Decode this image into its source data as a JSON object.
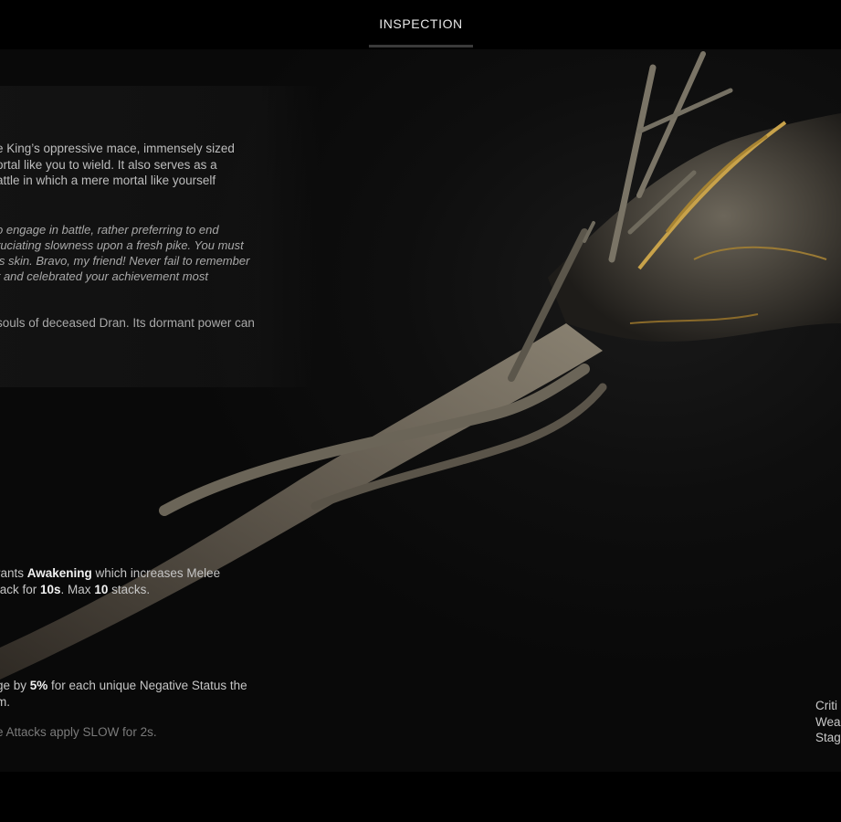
{
  "header": {
    "tab_label": "INSPECTION"
  },
  "lore": {
    "main": [
      "e King’s oppressive mace, immensely sized",
      "ortal like you to wield. It also serves as a",
      "attle in which a mere mortal like yourself"
    ],
    "quote": [
      "o engage in battle, rather preferring to end",
      "ruciating slowness upon a fresh pike. You must",
      "is skin. Bravo, my friend! Never fail to remember",
      "r and celebrated your achievement most"
    ],
    "souls": [
      "souls of deceased Dran. Its dormant power can"
    ]
  },
  "mod": {
    "l1_a": "rants ",
    "l1_b": "Awakening",
    "l1_c": " which increases Melee",
    "l2_a": "tack for ",
    "l2_b": "10s",
    "l2_c": ". Max ",
    "l2_d": "10",
    "l2_e": " stacks."
  },
  "trait": {
    "l1_a": "ge by ",
    "l1_b": "5%",
    "l1_c": " for each unique Negative Status the",
    "l2": "m."
  },
  "mutator": {
    "text": "e Attacks apply SLOW for 2s."
  },
  "stats": {
    "labels": [
      "Criti",
      "Wea",
      "Stag"
    ]
  },
  "colors": {
    "gold_inlay": "#c8a24a",
    "panel_bg": "#161616"
  }
}
